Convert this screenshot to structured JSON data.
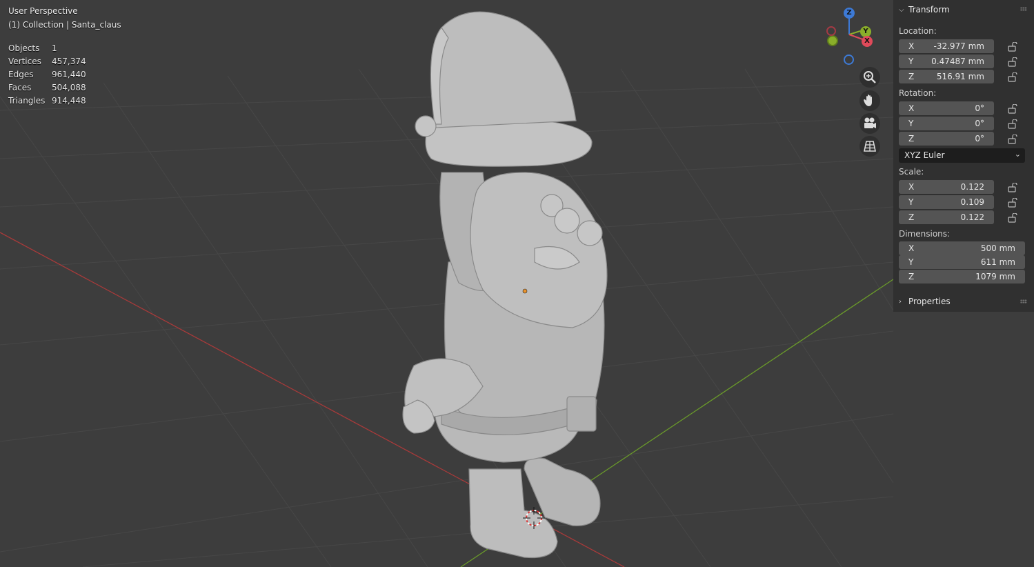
{
  "viewport": {
    "title": "User Perspective",
    "collection": "(1) Collection | Santa_claus"
  },
  "stats": [
    {
      "label": "Objects",
      "value": "1"
    },
    {
      "label": "Vertices",
      "value": "457,374"
    },
    {
      "label": "Edges",
      "value": "961,440"
    },
    {
      "label": "Faces",
      "value": "504,088"
    },
    {
      "label": "Triangles",
      "value": "914,448"
    }
  ],
  "gizmo": {
    "z": "Z",
    "y": "Y",
    "x": "X"
  },
  "nav_icons": [
    "zoom-icon",
    "hand-pan-icon",
    "camera-icon",
    "grid-ortho-icon"
  ],
  "transform": {
    "header": "Transform",
    "location_label": "Location:",
    "location": [
      {
        "axis": "X",
        "value": "-32.977 mm"
      },
      {
        "axis": "Y",
        "value": "0.47487 mm"
      },
      {
        "axis": "Z",
        "value": "516.91 mm"
      }
    ],
    "rotation_label": "Rotation:",
    "rotation": [
      {
        "axis": "X",
        "value": "0°"
      },
      {
        "axis": "Y",
        "value": "0°"
      },
      {
        "axis": "Z",
        "value": "0°"
      }
    ],
    "rotation_mode": "XYZ Euler",
    "scale_label": "Scale:",
    "scale": [
      {
        "axis": "X",
        "value": "0.122"
      },
      {
        "axis": "Y",
        "value": "0.109"
      },
      {
        "axis": "Z",
        "value": "0.122"
      }
    ],
    "dimensions_label": "Dimensions:",
    "dimensions": [
      {
        "axis": "X",
        "value": "500 mm"
      },
      {
        "axis": "Y",
        "value": "611 mm"
      },
      {
        "axis": "Z",
        "value": "1079 mm"
      }
    ]
  },
  "properties": {
    "header": "Properties"
  },
  "colors": {
    "viewport_bg": "#3d3d3d",
    "x_axis": "#a83a3a",
    "y_axis": "#6a9a2a",
    "gizmo_x": "#e04a5a",
    "gizmo_y": "#8aae2a",
    "gizmo_z": "#3d7ad6",
    "field_bg": "#545454",
    "panel_bg": "#303030"
  }
}
